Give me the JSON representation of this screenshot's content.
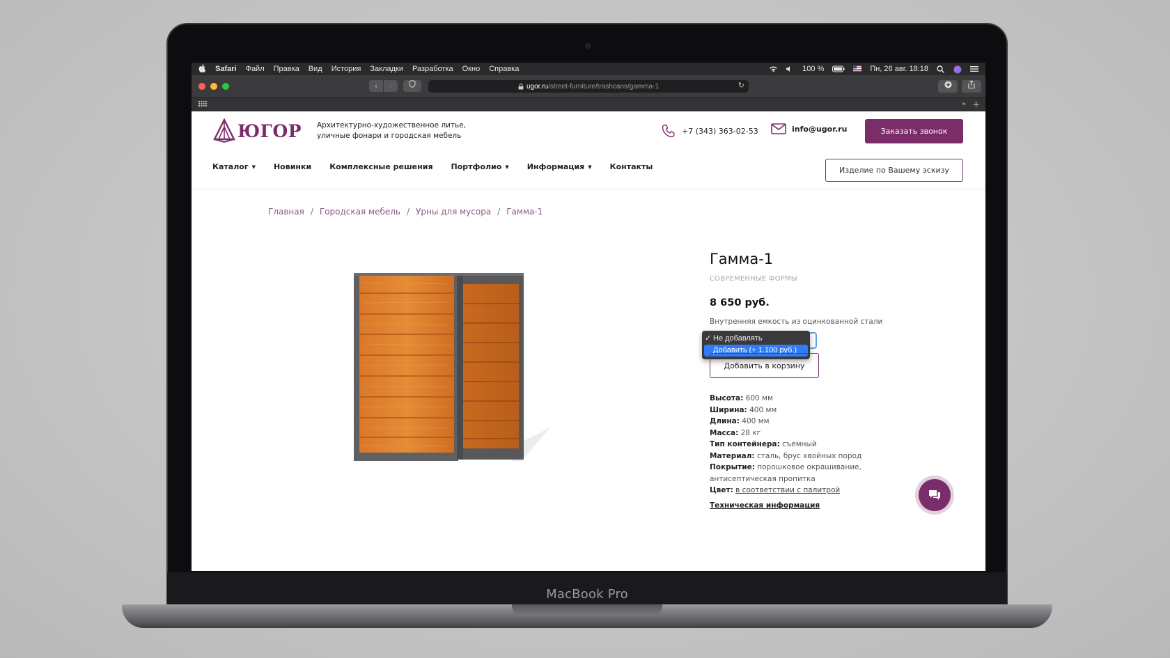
{
  "device": {
    "label": "MacBook Pro"
  },
  "menubar": {
    "app": "Safari",
    "items": [
      "Файл",
      "Правка",
      "Вид",
      "История",
      "Закладки",
      "Разработка",
      "Окно",
      "Справка"
    ],
    "battery": "100 %",
    "datetime": "Пн, 26 авг.  18:18",
    "icons": [
      "apple-icon",
      "wifi-icon",
      "volume-icon",
      "battery-icon",
      "flag-icon",
      "search-icon",
      "siri-icon",
      "control-center-icon"
    ]
  },
  "browser": {
    "url_host": "ugor.ru",
    "url_path": "/street-furniture/trashcans/gamma-1",
    "lights": [
      "#ff5f57",
      "#febc2e",
      "#28c840"
    ]
  },
  "site": {
    "logo": "ЮГОР",
    "tagline_1": "Архитектурно-художественное литье,",
    "tagline_2": "уличные фонари и городская мебель",
    "phone": "+7 (343) 363-02-53",
    "email": "info@ugor.ru",
    "call_button": "Заказать звонок",
    "sketch_button": "Изделие по Вашему эскизу",
    "nav": [
      {
        "label": "Каталог",
        "dropdown": true
      },
      {
        "label": "Новинки",
        "dropdown": false
      },
      {
        "label": "Комплексные решения",
        "dropdown": false
      },
      {
        "label": "Портфолио",
        "dropdown": true
      },
      {
        "label": "Информация",
        "dropdown": true
      },
      {
        "label": "Контакты",
        "dropdown": false
      }
    ],
    "breadcrumbs": [
      "Главная",
      "Городская мебель",
      "Урны для мусора",
      "Гамма-1"
    ],
    "accent": "#7b2d69"
  },
  "product": {
    "title": "Гамма-1",
    "subtitle": "СОВРЕМЕННЫЕ ФОРМЫ",
    "price": "8 650 руб.",
    "option_label": "Внутренняя емкость из оцинкованной стали",
    "options": [
      {
        "label": "Не добавлять",
        "selected": true,
        "highlighted": false
      },
      {
        "label": "Добавить (+ 1.100 руб.)",
        "selected": false,
        "highlighted": true
      }
    ],
    "cart_button": "Добавить в корзину",
    "specs": {
      "height_k": "Высота:",
      "height_v": "600 мм",
      "width_k": "Ширина:",
      "width_v": "400 мм",
      "length_k": "Длина:",
      "length_v": "400 мм",
      "mass_k": "Масса:",
      "mass_v": "28 кг",
      "container_k": "Тип контейнера:",
      "container_v": "съемный",
      "material_k": "Материал:",
      "material_v": "сталь, брус хвойных пород",
      "coating_k": "Покрытие:",
      "coating_v": "порошковое окрашивание, антисептическая пропитка",
      "color_k": "Цвет:",
      "color_v": "в соответствии с палитрой"
    },
    "tech_info": "Техническая информация"
  }
}
